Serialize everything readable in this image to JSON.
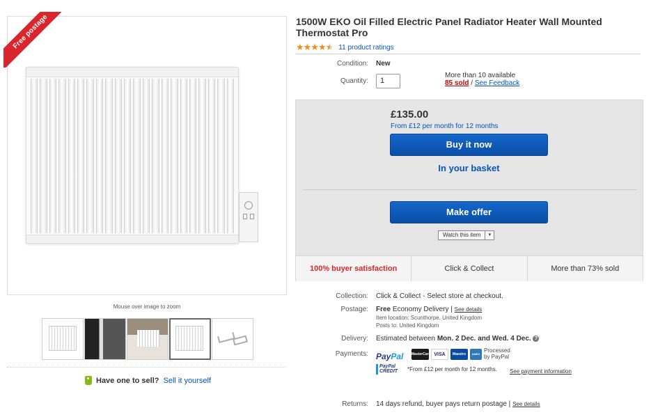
{
  "gallery": {
    "ribbon": "Free postage",
    "zoom_hint": "Mouse over image to zoom",
    "sell_prompt": "Have one to sell?",
    "sell_link": "Sell it yourself"
  },
  "product": {
    "title": "1500W EKO Oil Filled Electric Panel Radiator Heater Wall Mounted Thermostat Pro",
    "rating_stars": 4.5,
    "ratings_link": "11 product ratings"
  },
  "condition": {
    "label": "Condition:",
    "value": "New"
  },
  "quantity": {
    "label": "Quantity:",
    "value": "1",
    "available": "More than 10 available",
    "sold": "85 sold",
    "separator": " / ",
    "feedback": "See Feedback"
  },
  "buybox": {
    "price": "£135.00",
    "finance": "From £12 per month for 12 months",
    "buy_now": "Buy it now",
    "in_basket": "In your basket",
    "make_offer": "Make offer",
    "watch": "Watch this item",
    "watch_arrow": "▾",
    "stats": [
      "100% buyer satisfaction",
      "Click & Collect",
      "More than 73% sold"
    ]
  },
  "details": {
    "collection_label": "Collection:",
    "collection_value": "Click & Collect - Select store at checkout.",
    "postage_label": "Postage:",
    "postage_free": "Free",
    "postage_service": "Economy Delivery |",
    "postage_link": "See details",
    "item_location": "Item location:  Scunthorpe, United Kingdom",
    "posts_to": "Posts to:  United Kingdom",
    "delivery_label": "Delivery:",
    "delivery_prefix": "Estimated between",
    "delivery_dates": "Mon. 2 Dec. and Wed. 4 Dec.",
    "payments_label": "Payments:",
    "paypal_a": "Pay",
    "paypal_b": "Pal",
    "cards": [
      "MasterCard",
      "VISA",
      "Maestro",
      "AMEX"
    ],
    "processed": "Processed",
    "by_paypal": "by PayPal",
    "ppcredit": "PayPal CREDIT",
    "credit_text": "*From £12 per month for 12 months.",
    "payment_link": "See payment information",
    "returns_label": "Returns:",
    "returns_value": "14 days refund, buyer pays return postage |",
    "returns_link": "See details"
  },
  "colors": {
    "accent": "#0654ba",
    "button": "#1467c9",
    "ribbon": "#d9252b",
    "stars": "#f18c1f"
  }
}
